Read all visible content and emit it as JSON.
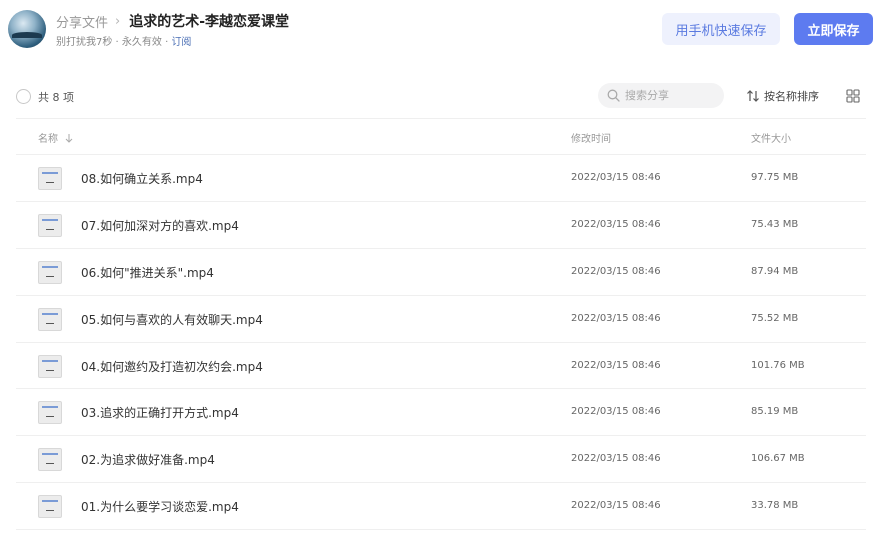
{
  "header": {
    "breadcrumb_root": "分享文件",
    "breadcrumb_sep": "›",
    "title": "追求的艺术-李越恋爱课堂",
    "subline_text": "别打扰我7秒 · 永久有效 · ",
    "subline_link": "订阅",
    "mobile_save_label": "用手机快速保存",
    "save_label": "立即保存"
  },
  "toolbar": {
    "count_label": "共 8 项",
    "search_placeholder": "搜索分享",
    "sort_label": "按名称排序"
  },
  "table": {
    "col_name": "名称",
    "col_mtime": "修改时间",
    "col_size": "文件大小",
    "rows": [
      {
        "name": "08.如何确立关系.mp4",
        "mtime": "2022/03/15 08:46",
        "size": "97.75 MB"
      },
      {
        "name": "07.如何加深对方的喜欢.mp4",
        "mtime": "2022/03/15 08:46",
        "size": "75.43 MB"
      },
      {
        "name": "06.如何\"推进关系\".mp4",
        "mtime": "2022/03/15 08:46",
        "size": "87.94 MB"
      },
      {
        "name": "05.如何与喜欢的人有效聊天.mp4",
        "mtime": "2022/03/15 08:46",
        "size": "75.52 MB"
      },
      {
        "name": "04.如何邀约及打造初次约会.mp4",
        "mtime": "2022/03/15 08:46",
        "size": "101.76 MB"
      },
      {
        "name": "03.追求的正确打开方式.mp4",
        "mtime": "2022/03/15 08:46",
        "size": "85.19 MB"
      },
      {
        "name": "02.为追求做好准备.mp4",
        "mtime": "2022/03/15 08:46",
        "size": "106.67 MB"
      },
      {
        "name": "01.为什么要学习谈恋爱.mp4",
        "mtime": "2022/03/15 08:46",
        "size": "33.78 MB"
      }
    ]
  },
  "icons": {
    "search": "search-icon",
    "sort": "sort-arrows-icon",
    "grid": "grid-view-icon",
    "sort_dir": "arrow-down-icon",
    "file": "video-file-icon"
  },
  "colors": {
    "primary": "#5d7bf0",
    "primary_light": "#eef1fd",
    "link": "#4b6fb5"
  }
}
